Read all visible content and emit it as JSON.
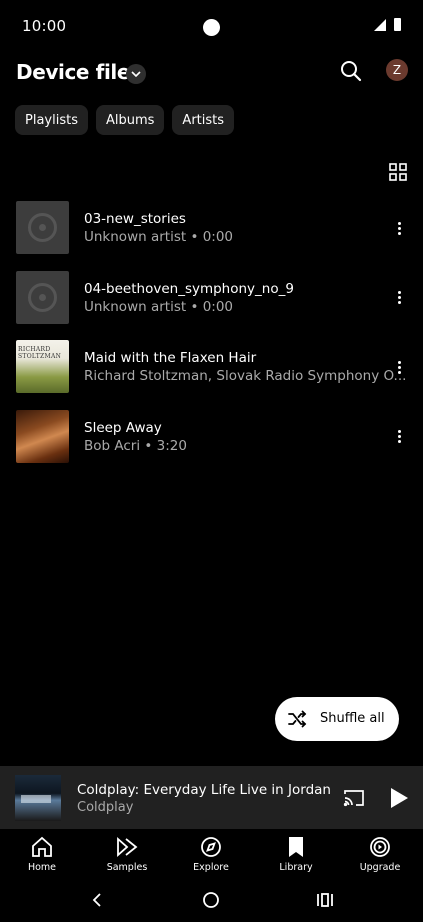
{
  "status": {
    "time": "10:00"
  },
  "header": {
    "title": "Device files"
  },
  "avatar": {
    "initial": "Z"
  },
  "chips": [
    "Playlists",
    "Albums",
    "Artists"
  ],
  "tracks": [
    {
      "title": "03-new_stories",
      "subtitle": "Unknown artist • 0:00",
      "art": "placeholder"
    },
    {
      "title": "04-beethoven_symphony_no_9",
      "subtitle": "Unknown artist • 0:00",
      "art": "placeholder"
    },
    {
      "title": "Maid with the Flaxen Hair",
      "subtitle": "Richard Stoltzman, Slovak Radio Symphony O...",
      "art": "album-cover",
      "art_text": "RICHARD STOLTZMAN"
    },
    {
      "title": "Sleep Away",
      "subtitle": "Bob Acri • 3:20",
      "art": "album-cover"
    }
  ],
  "shuffle": {
    "label": "Shuffle all"
  },
  "mini_player": {
    "title": "Coldplay: Everyday Life Live in Jordan",
    "artist": "Coldplay"
  },
  "nav": [
    {
      "label": "Home",
      "icon": "home-icon"
    },
    {
      "label": "Samples",
      "icon": "samples-icon"
    },
    {
      "label": "Explore",
      "icon": "compass-icon"
    },
    {
      "label": "Library",
      "icon": "library-icon"
    },
    {
      "label": "Upgrade",
      "icon": "upgrade-icon"
    }
  ],
  "colors": {
    "background": "#000000",
    "surface": "#212121",
    "chip": "#212121",
    "accent_button": "#ffffff",
    "secondary_text": "#aaaaaa"
  }
}
